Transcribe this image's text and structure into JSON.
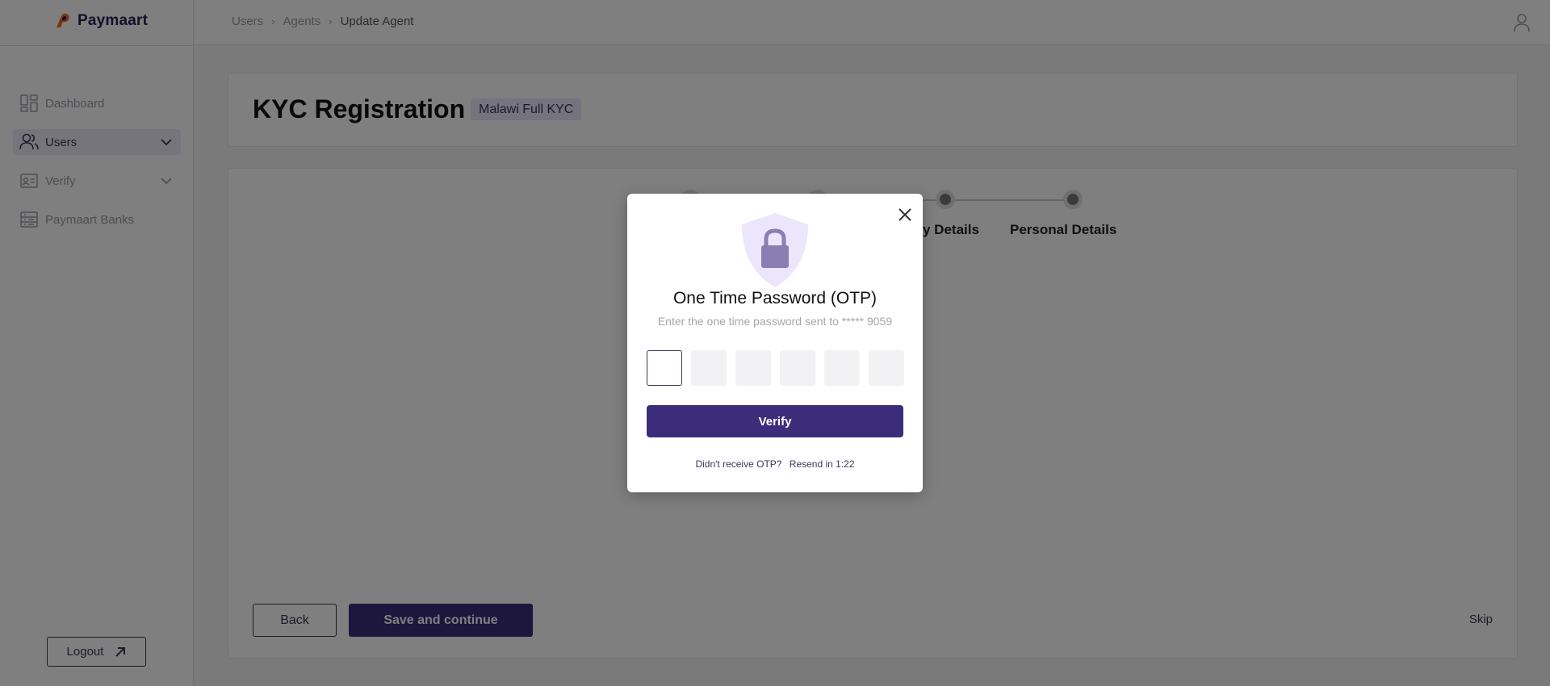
{
  "brand": {
    "name": "Paymaart"
  },
  "sidebar": {
    "items": [
      {
        "label": "Dashboard",
        "icon": "dashboard-icon"
      },
      {
        "label": "Users",
        "icon": "users-icon"
      },
      {
        "label": "Verify",
        "icon": "id-card-icon"
      },
      {
        "label": "Paymaart Banks",
        "icon": "bank-list-icon"
      }
    ],
    "logout_label": "Logout"
  },
  "header": {
    "breadcrumb": [
      "Users",
      "Agents",
      "Update Agent"
    ]
  },
  "page": {
    "title": "KYC Registration",
    "kyc_badge": "Malawi Full KYC"
  },
  "stepper": {
    "steps": [
      "",
      "",
      "y Details",
      "Personal Details"
    ]
  },
  "actions": {
    "back_label": "Back",
    "save_label": "Save and continue",
    "skip_label": "Skip"
  },
  "modal": {
    "title": "One Time Password (OTP)",
    "subtitle": "Enter the one time password sent to ***** 9059",
    "verify_label": "Verify",
    "resend_prompt": "Didn't receive OTP?",
    "resend_timer": "Resend in 1:22",
    "otp_length": 6
  },
  "colors": {
    "primary": "#3b2d7a",
    "accent_orange": "#f26b1d",
    "badge_bg": "#ebe6fb"
  }
}
